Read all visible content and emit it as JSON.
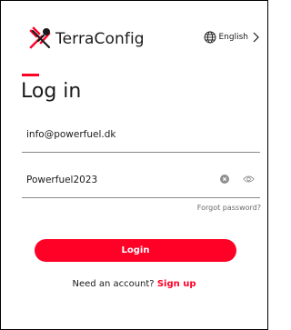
{
  "brand": {
    "name": "TerraConfig",
    "accent_color": "#ff0026"
  },
  "language": {
    "label": "English",
    "icon": "globe-icon"
  },
  "page": {
    "title": "Log in"
  },
  "form": {
    "email_value": "info@powerfuel.dk",
    "password_value": "Powerfuel2023",
    "forgot_label": "Forgot password?",
    "login_label": "Login"
  },
  "signup": {
    "prompt": "Need an account?",
    "link_label": "Sign up"
  }
}
